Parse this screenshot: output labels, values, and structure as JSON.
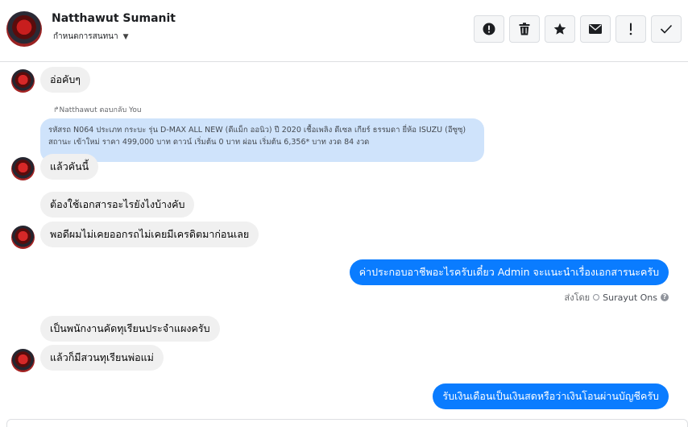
{
  "header": {
    "name": "Natthawut Sumanit",
    "subtitle": "กำหนดการสนทนา"
  },
  "actions": [
    {
      "icon": "alert-circle-icon",
      "glyph": "!"
    },
    {
      "icon": "trash-icon"
    },
    {
      "icon": "star-icon"
    },
    {
      "icon": "envelope-icon"
    },
    {
      "icon": "exclamation-icon",
      "glyph": "!"
    },
    {
      "icon": "check-icon"
    }
  ],
  "messages": {
    "m1": "อ่อคับๆ",
    "reply_label": "Natthawut ตอบกลับ You",
    "reply_quote": "รหัสรถ N064 ประเภท กระบะ รุ่น D-MAX ALL NEW (ดีแม็ก ออนิว) ปี 2020 เชื้อเพลิง ดีเซล เกียร์ ธรรมดา ยี่ห้อ ISUZU (อีซูซุ) สถานะ เข้าใหม่ ราคา 499,000 บาท ดาวน์ เริ่มต้น 0 บาท ผ่อน เริ่มต้น 6,356* บาท งวด 84 งวด",
    "m2": "แล้วคันนี้",
    "m3": "ต้องใช้เอกสารอะไรยังไงบ้างคับ",
    "m4": "พอดีผมไม่เคยออกรถไม่เคยมีเครดิตมาก่อนเลย",
    "m5": "ค่าประกอบอาชีพอะไรครับเดี๋ยว Admin จะแนะนำเรื่องเอกสารนะครับ",
    "sent_by_prefix": "ส่งโดย",
    "sent_by_name": "Surayut Ons",
    "m6": "เป็นพนักงานคัดทุเรียนประจำแผงครับ",
    "m7": "แล้วก็มีสวนทุเรียนพ่อแม่",
    "m8": "รับเงินเดือนเป็นเงินสดหรือว่าเงินโอนผ่านบัญชีครับ"
  },
  "colors": {
    "outgoing": "#0a7cff",
    "incoming": "#f0f0f0",
    "quote": "#cfe3fb"
  }
}
